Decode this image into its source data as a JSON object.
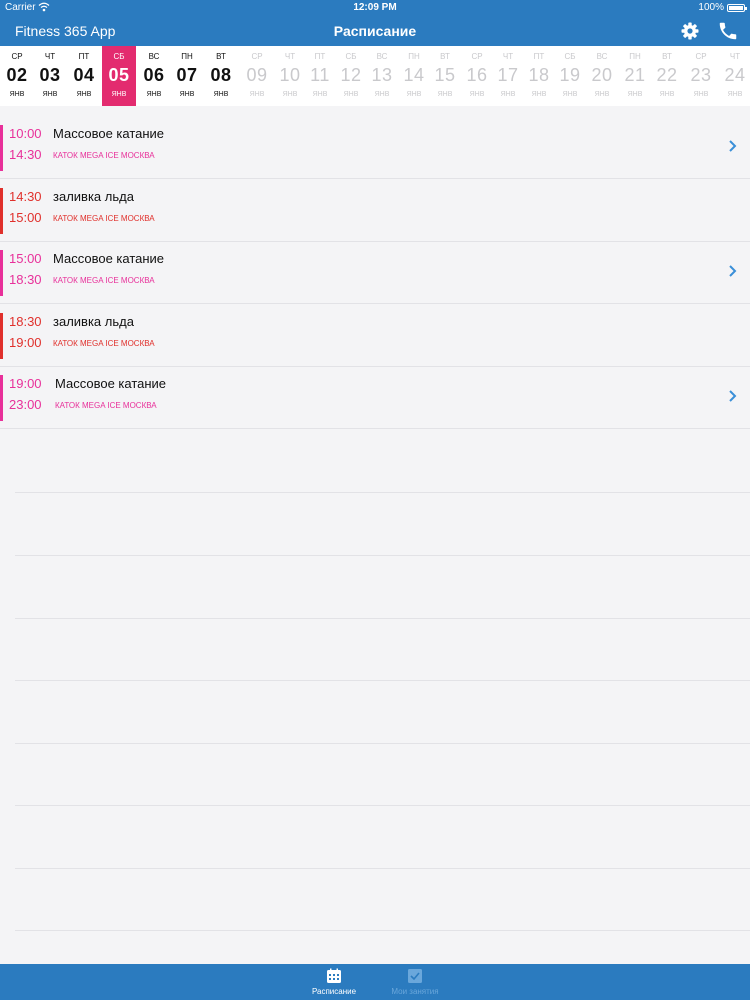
{
  "status_bar": {
    "carrier": "Carrier",
    "time": "12:09 PM",
    "battery": "100%"
  },
  "nav": {
    "app_title": "Fitness 365 App",
    "page_title": "Расписание"
  },
  "dates": [
    {
      "dow": "СР",
      "num": "02",
      "mon": "ЯНВ",
      "state": "active"
    },
    {
      "dow": "ЧТ",
      "num": "03",
      "mon": "ЯНВ",
      "state": "active"
    },
    {
      "dow": "ПТ",
      "num": "04",
      "mon": "ЯНВ",
      "state": "active"
    },
    {
      "dow": "СБ",
      "num": "05",
      "mon": "ЯНВ",
      "state": "selected"
    },
    {
      "dow": "ВС",
      "num": "06",
      "mon": "ЯНВ",
      "state": "active"
    },
    {
      "dow": "ПН",
      "num": "07",
      "mon": "ЯНВ",
      "state": "active"
    },
    {
      "dow": "ВТ",
      "num": "08",
      "mon": "ЯНВ",
      "state": "active"
    },
    {
      "dow": "СР",
      "num": "09",
      "mon": "ЯНВ",
      "state": "faded"
    },
    {
      "dow": "ЧТ",
      "num": "10",
      "mon": "ЯНВ",
      "state": "faded"
    },
    {
      "dow": "ПТ",
      "num": "11",
      "mon": "ЯНВ",
      "state": "faded"
    },
    {
      "dow": "СБ",
      "num": "12",
      "mon": "ЯНВ",
      "state": "faded"
    },
    {
      "dow": "ВС",
      "num": "13",
      "mon": "ЯНВ",
      "state": "faded"
    },
    {
      "dow": "ПН",
      "num": "14",
      "mon": "ЯНВ",
      "state": "faded"
    },
    {
      "dow": "ВТ",
      "num": "15",
      "mon": "ЯНВ",
      "state": "faded"
    },
    {
      "dow": "СР",
      "num": "16",
      "mon": "ЯНВ",
      "state": "faded"
    },
    {
      "dow": "ЧТ",
      "num": "17",
      "mon": "ЯНВ",
      "state": "faded"
    },
    {
      "dow": "ПТ",
      "num": "18",
      "mon": "ЯНВ",
      "state": "faded"
    },
    {
      "dow": "СБ",
      "num": "19",
      "mon": "ЯНВ",
      "state": "faded"
    },
    {
      "dow": "ВС",
      "num": "20",
      "mon": "ЯНВ",
      "state": "faded"
    },
    {
      "dow": "ПН",
      "num": "21",
      "mon": "ЯНВ",
      "state": "faded"
    },
    {
      "dow": "ВТ",
      "num": "22",
      "mon": "ЯНВ",
      "state": "faded"
    },
    {
      "dow": "СР",
      "num": "23",
      "mon": "ЯНВ",
      "state": "faded"
    },
    {
      "dow": "ЧТ",
      "num": "24",
      "mon": "ЯНВ",
      "state": "faded"
    }
  ],
  "sessions": [
    {
      "start": "10:00",
      "end": "14:30",
      "name": "Массовое катание",
      "venue": "КАТОК MEGA ICE МОСКВА",
      "color": "#e8309a",
      "chevron": true
    },
    {
      "start": "14:30",
      "end": "15:00",
      "name": "заливка льда",
      "venue": "КАТОК MEGA ICE МОСКВА",
      "color": "#e0302c",
      "chevron": false
    },
    {
      "start": "15:00",
      "end": "18:30",
      "name": "Массовое катание",
      "venue": "КАТОК MEGA ICE МОСКВА",
      "color": "#e8309a",
      "chevron": true
    },
    {
      "start": "18:30",
      "end": "19:00",
      "name": "заливка льда",
      "venue": "КАТОК MEGA ICE МОСКВА",
      "color": "#e0302c",
      "chevron": false
    },
    {
      "start": "19:00",
      "end": "23:00",
      "name": "Массовое катание",
      "venue": "КАТОК MEGA ICE МОСКВА",
      "color": "#e8309a",
      "chevron": true
    }
  ],
  "tabs": [
    {
      "label": "Расписание",
      "icon": "calendar-icon",
      "active": true
    },
    {
      "label": "Мои занятия",
      "icon": "checkbox-icon",
      "active": false
    }
  ],
  "colors": {
    "brand": "#2b7bbf",
    "selected_day": "#e32b6f",
    "mass_skating": "#e8309a",
    "ice_resurfacing": "#e0302c",
    "chevron": "#3a8fd8"
  }
}
